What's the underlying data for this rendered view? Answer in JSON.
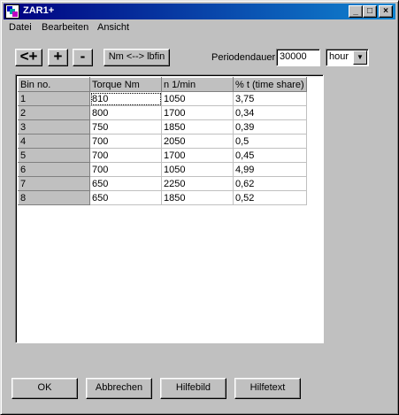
{
  "window": {
    "title": "ZAR1+",
    "controls": {
      "minimize": "_",
      "maximize": "□",
      "close": "×"
    }
  },
  "menu": [
    {
      "label": "Datei"
    },
    {
      "label": "Bearbeiten"
    },
    {
      "label": "Ansicht"
    }
  ],
  "toolbar": {
    "insert_label": "<+",
    "add_label": "+",
    "remove_label": "-",
    "unit_toggle_label": "Nm <--> lbfin",
    "period_label": "Periodendauer",
    "period_value": "30000",
    "unit_value": "hour"
  },
  "table": {
    "headers": [
      "Bin no.",
      "Torque Nm",
      "n 1/min",
      "% t (time share)"
    ],
    "rows": [
      [
        "1",
        "810",
        "1050",
        "3,75"
      ],
      [
        "2",
        "800",
        "1700",
        "0,34"
      ],
      [
        "3",
        "750",
        "1850",
        "0,39"
      ],
      [
        "4",
        "700",
        "2050",
        "0,5"
      ],
      [
        "5",
        "700",
        "1700",
        "0,45"
      ],
      [
        "6",
        "700",
        "1050",
        "4,99"
      ],
      [
        "7",
        "650",
        "2250",
        "0,62"
      ],
      [
        "8",
        "650",
        "1850",
        "0,52"
      ]
    ]
  },
  "buttons": {
    "ok": "OK",
    "cancel": "Abbrechen",
    "help_image": "Hilfebild",
    "help_text": "Hilfetext"
  }
}
